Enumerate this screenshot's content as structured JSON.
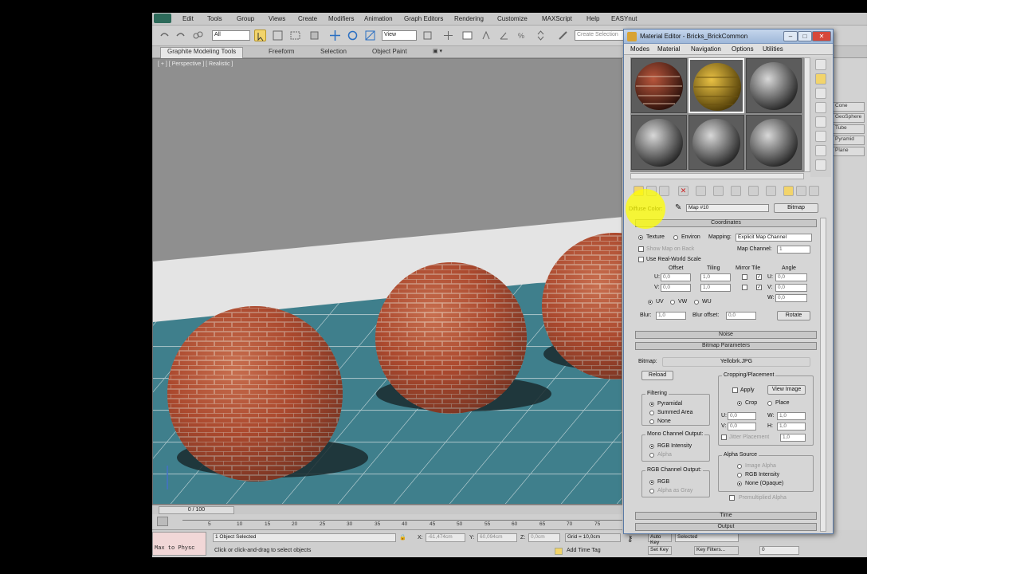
{
  "menubar": {
    "items": [
      "Edit",
      "Tools",
      "Group",
      "Views",
      "Create",
      "Modifiers",
      "Animation",
      "Graph Editors",
      "Rendering",
      "Customize",
      "MAXScript",
      "Help",
      "EASYnut"
    ]
  },
  "toolbar": {
    "selection_filter": "All",
    "ref_coord": "View",
    "named_selection_placeholder": "Create Selection"
  },
  "ribbon": {
    "tabs": [
      "Graphite Modeling Tools",
      "Freeform",
      "Selection",
      "Object Paint"
    ],
    "active_tab": "Graphite Modeling Tools"
  },
  "viewport": {
    "label": "[ + ] [ Perspective ] [ Realistic ]"
  },
  "timeline": {
    "slider": "0 / 100",
    "ticks": [
      "0",
      "5",
      "10",
      "15",
      "20",
      "25",
      "30",
      "35",
      "40",
      "45",
      "50",
      "55",
      "60",
      "65",
      "70",
      "75",
      "80",
      "85",
      "90",
      "95",
      "100"
    ]
  },
  "status": {
    "maxscript_text": "Max to Physc",
    "objects_selected": "1 Object Selected",
    "prompt": "Click or click-and-drag to select objects",
    "x_label": "X:",
    "x_value": "-61,474cm",
    "y_label": "Y:",
    "y_value": "60,094cm",
    "z_label": "Z:",
    "z_value": "0,0cm",
    "grid": "Grid = 10,0cm",
    "add_time_tag": "Add Time Tag",
    "auto_key": "Auto Key",
    "selected": "Selected",
    "set_key": "Set Key",
    "key_filters": "Key Filters...",
    "frame": "0"
  },
  "command_panel": {
    "items": [
      "Cone",
      "GeoSphere",
      "Tube",
      "Pyramid",
      "Plane"
    ]
  },
  "material_editor": {
    "title": "Material Editor - Bricks_BrickCommon",
    "menu": [
      "Modes",
      "Material",
      "Navigation",
      "Options",
      "Utilities"
    ],
    "map_label": "Diffuse Color:",
    "map_name": "Map #10",
    "map_type": "Bitmap",
    "rollouts": {
      "coordinates": "Coordinates",
      "noise": "Noise",
      "bitmap_params": "Bitmap Parameters",
      "time": "Time",
      "output": "Output"
    },
    "coords": {
      "texture": "Texture",
      "environ": "Environ",
      "mapping_label": "Mapping:",
      "mapping_value": "Explicit Map Channel",
      "show_map_on_back": "Show Map on Back",
      "map_channel_label": "Map Channel:",
      "map_channel_value": "1",
      "use_real_world": "Use Real-World Scale",
      "offset": "Offset",
      "tiling": "Tiling",
      "mirror_tile": "Mirror Tile",
      "angle": "Angle",
      "u": "U:",
      "v": "V:",
      "w": "W:",
      "u_offset": "0,0",
      "v_offset": "0,0",
      "u_tiling": "1,0",
      "v_tiling": "1,0",
      "u_angle": "0,0",
      "v_angle": "0,0",
      "w_angle": "0,0",
      "uv": "UV",
      "vw": "VW",
      "wu": "WU",
      "blur_label": "Blur:",
      "blur_value": "1,0",
      "blur_offset_label": "Blur offset:",
      "blur_offset_value": "0,0",
      "rotate": "Rotate"
    },
    "bitmap": {
      "label": "Bitmap:",
      "path": "Yellobrk.JPG",
      "reload": "Reload",
      "cropping_title": "Cropping/Placement",
      "apply": "Apply",
      "view_image": "View Image",
      "crop": "Crop",
      "place": "Place",
      "u": "U:",
      "v": "V:",
      "w": "W:",
      "h": "H:",
      "u_val": "0,0",
      "v_val": "0,0",
      "w_val": "1,0",
      "h_val": "1,0",
      "jitter": "Jitter Placement",
      "jitter_val": "1,0",
      "filtering_title": "Filtering",
      "pyramidal": "Pyramidal",
      "summed_area": "Summed Area",
      "none": "None",
      "mono_title": "Mono Channel Output:",
      "rgb_intensity": "RGB Intensity",
      "alpha": "Alpha",
      "rgb_title": "RGB Channel Output:",
      "rgb": "RGB",
      "alpha_as_gray": "Alpha as Gray",
      "alpha_source_title": "Alpha Source",
      "image_alpha": "Image Alpha",
      "as_rgb_intensity": "RGB Intensity",
      "none_opaque": "None (Opaque)",
      "premultiplied": "Premultiplied Alpha"
    }
  },
  "colors": {
    "accent": "#f4c400",
    "title_gradient_top": "#c5d6ec",
    "close": "#d6483a"
  }
}
